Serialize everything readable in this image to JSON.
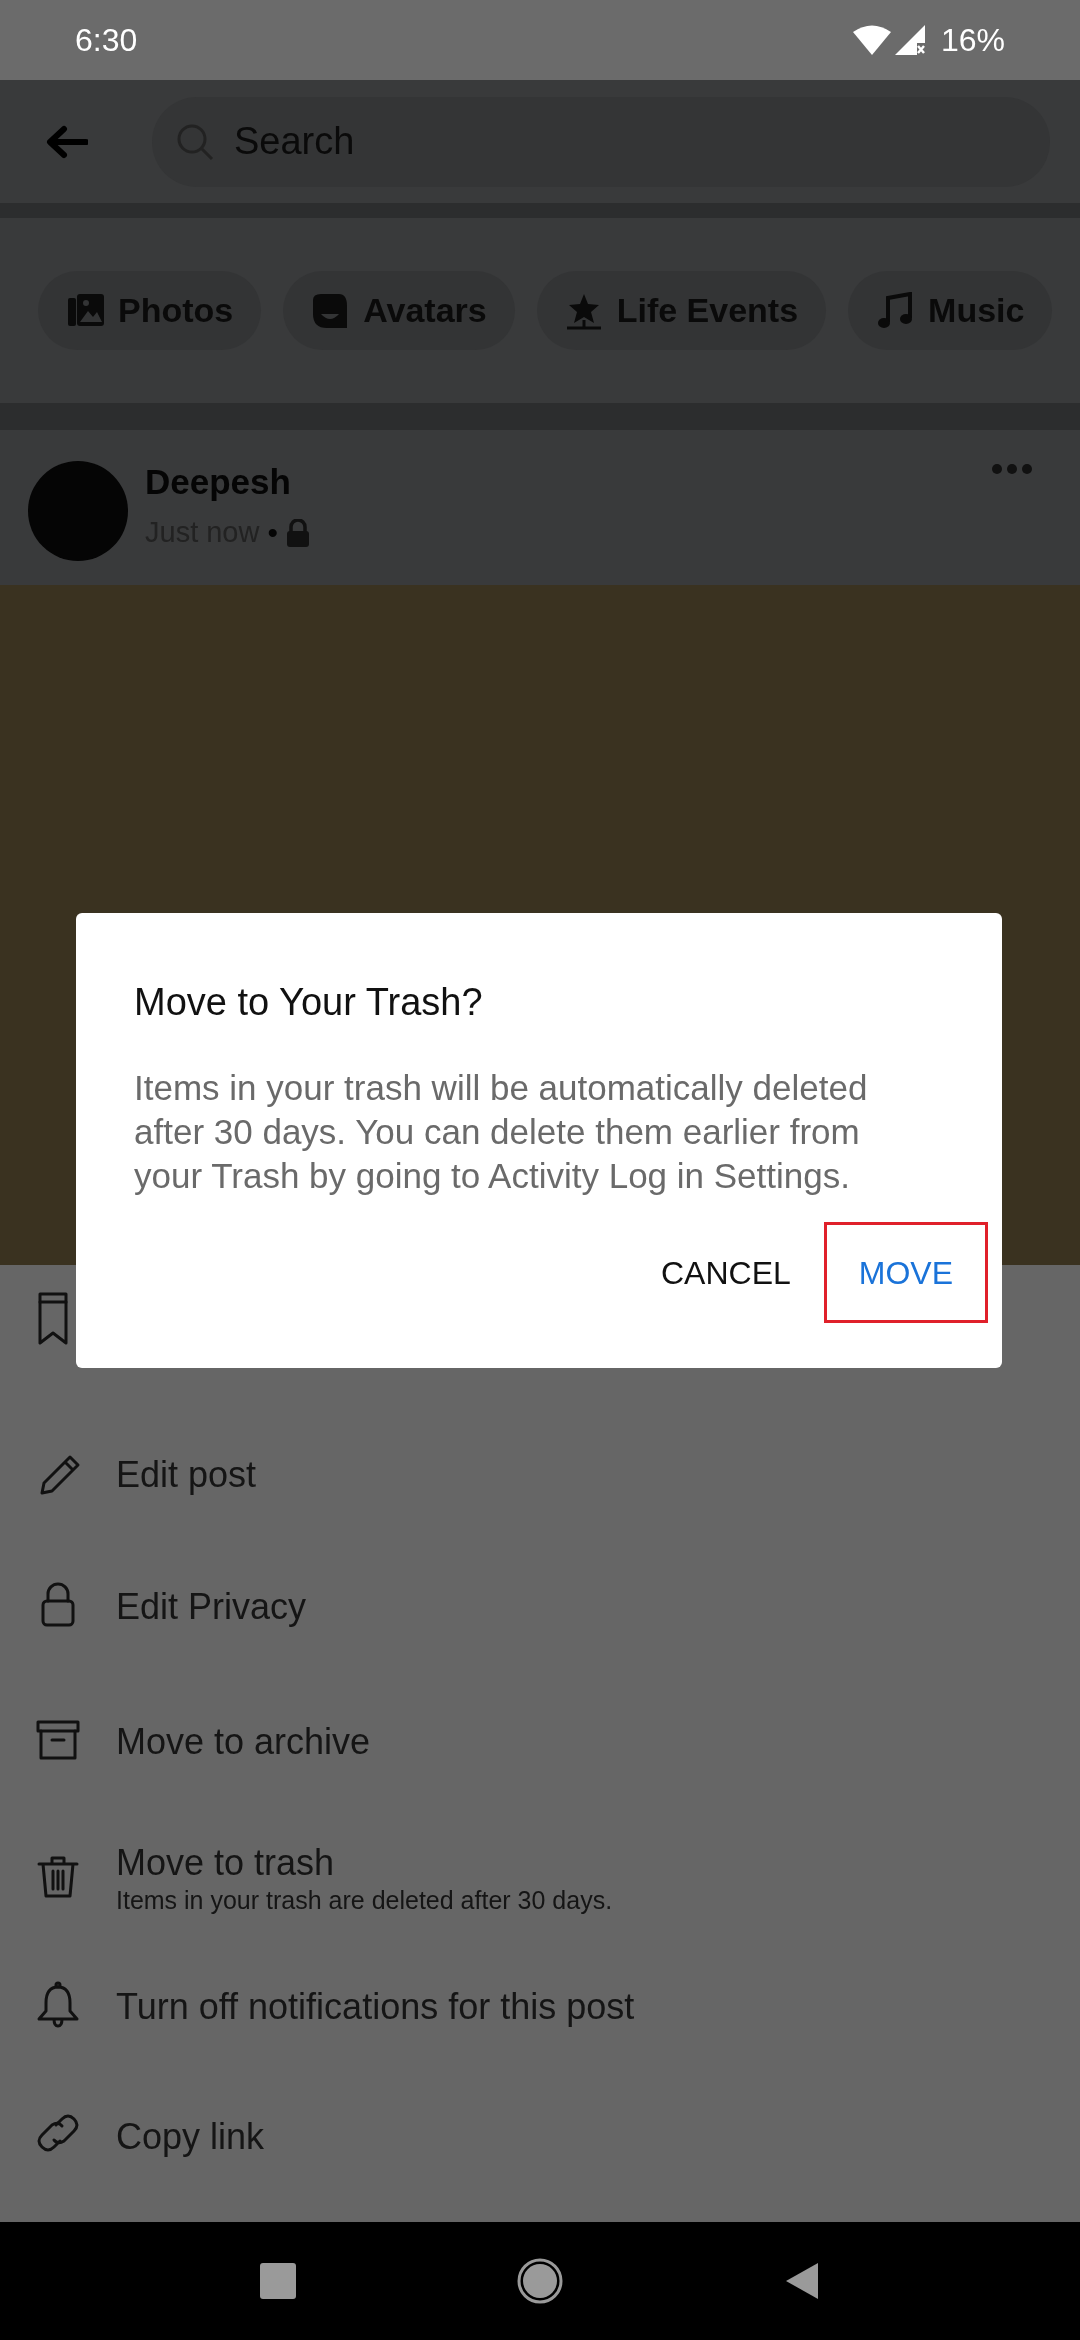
{
  "status_bar": {
    "time": "6:30",
    "battery": "16%"
  },
  "header": {
    "search": {
      "placeholder": "Search"
    }
  },
  "chips": [
    {
      "label": "Photos",
      "kind": "photos"
    },
    {
      "label": "Avatars",
      "kind": "avatar"
    },
    {
      "label": "Life Events",
      "kind": "star"
    },
    {
      "label": "Music",
      "kind": "music"
    }
  ],
  "post": {
    "author": "Deepesh",
    "time": "Just now",
    "separator": "•"
  },
  "menu": [
    {
      "kind": "bookmark"
    },
    {
      "kind": "pencil",
      "label": "Edit post"
    },
    {
      "kind": "lock",
      "label": "Edit Privacy"
    },
    {
      "kind": "archive",
      "label": "Move to archive"
    },
    {
      "kind": "trash",
      "label": "Move to trash",
      "subtitle": "Items in your trash are deleted after 30 days."
    },
    {
      "kind": "bell",
      "label": "Turn off notifications for this post"
    },
    {
      "kind": "link",
      "label": "Copy link"
    }
  ],
  "dialog": {
    "title": "Move to Your Trash?",
    "body": "Items in your trash will be automatically deleted after 30 days. You can delete them earlier from your Trash by going to Activity Log in Settings.",
    "buttons": [
      {
        "label": "CANCEL",
        "highlighted": false
      },
      {
        "label": "MOVE",
        "highlighted": true
      }
    ]
  }
}
